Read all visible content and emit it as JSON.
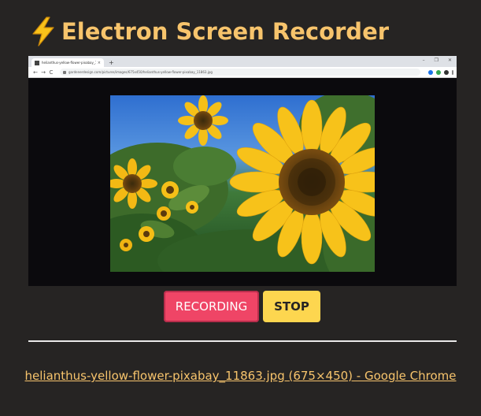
{
  "app": {
    "title": "Electron Screen Recorder",
    "title_icon": "lightning-bolt-icon",
    "title_color": "#f7c46c",
    "background_color": "#262423"
  },
  "preview": {
    "description_icon": "sunflower-image",
    "browser": {
      "tab_title": "helianthus-yellow-flower-pixabay_11863.jpg (675×450)",
      "tab_close": "×",
      "new_tab": "+",
      "window_controls": [
        "–",
        "❐",
        "✕"
      ],
      "nav": {
        "back": "←",
        "forward": "→",
        "reload": "C"
      },
      "url": "gardenerdesign.com/pictures/images/675x450/helianthus-yellow-flower-pixabay_11863.jpg"
    }
  },
  "controls": {
    "record_label": "RECORDING",
    "stop_label": "STOP",
    "record_color": "#ef4566",
    "stop_color": "#fdd64f"
  },
  "source": {
    "label": "helianthus-yellow-flower-pixabay_11863.jpg (675×450) - Google Chrome"
  }
}
